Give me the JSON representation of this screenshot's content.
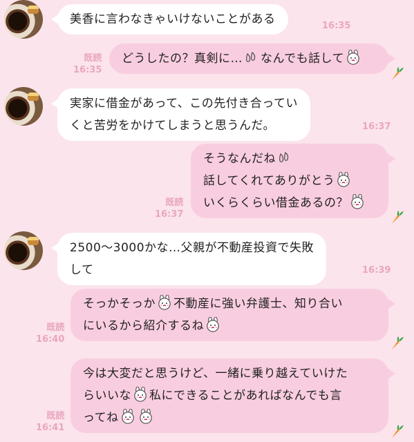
{
  "messages": [
    {
      "side": "in",
      "lines": [
        "美香に言わなきゃいけないことがある"
      ],
      "time": "16:35"
    },
    {
      "side": "out",
      "read": "既読",
      "time": "16:35",
      "lines": [
        "どうしたの？真剣に…",
        "なんでも話して"
      ]
    },
    {
      "side": "in",
      "lines": [
        "実家に借金があって、この先付き合ってい",
        "くと苦労をかけてしまうと思うんだ。"
      ],
      "time": "16:37"
    },
    {
      "side": "out",
      "read": "既読",
      "time": "16:37",
      "lines": [
        "そうなんだね",
        "話してくれてありがとう",
        "いくらくらい借金あるの？"
      ]
    },
    {
      "side": "in",
      "lines": [
        "2500～3000かな…父親が不動産投資で失敗",
        "して"
      ],
      "time": "16:39"
    },
    {
      "side": "out",
      "read": "既読",
      "time": "16:40",
      "lines": [
        "そっかそっか",
        "不動産に強い弁護士、知り合い",
        "にいるから紹介するね"
      ]
    },
    {
      "side": "out",
      "read": "既読",
      "time": "16:41",
      "lines": [
        "今は大変だと思うけど、一緒に乗り越えていけた",
        "らいいな",
        "私にできることがあればなんでも言",
        "ってね"
      ]
    }
  ],
  "icons": {
    "sweat": "sweat-drop-icon",
    "bunny": "bunny-sticker-icon",
    "carrot": "carrot-icon"
  }
}
